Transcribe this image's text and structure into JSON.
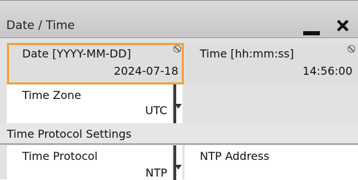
{
  "window": {
    "title": "Date / Time",
    "minimize_icon": "minimize-icon",
    "close_icon": "close-icon"
  },
  "date": {
    "label": "Date [YYYY-MM-DD]",
    "value": "2024-07-18",
    "status_icon": "locked-icon"
  },
  "time": {
    "label": "Time [hh:mm:ss]",
    "value": "14:56:00",
    "status_icon": "locked-icon"
  },
  "time_zone": {
    "label": "Time Zone",
    "value": "UTC",
    "dropdown_icon": "dropdown-arrow-icon"
  },
  "section": {
    "title": "Time Protocol Settings"
  },
  "time_protocol": {
    "label": "Time Protocol",
    "value": "NTP",
    "dropdown_icon": "dropdown-arrow-icon"
  },
  "ntp_address": {
    "label": "NTP Address",
    "value": ""
  },
  "colors": {
    "focus_border": "#f0a040",
    "titlebar": "#d0d0d0",
    "field_bg": "#ffffff",
    "panel_bg": "#e2e2e2"
  }
}
